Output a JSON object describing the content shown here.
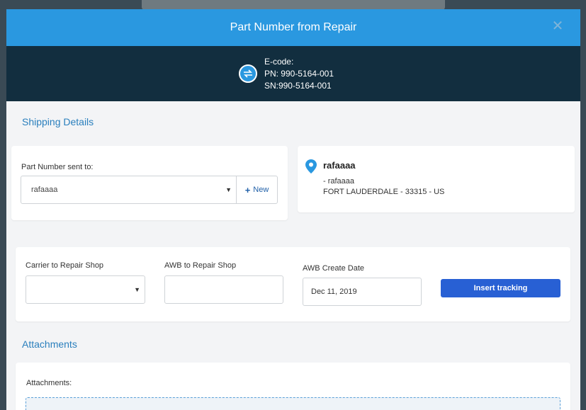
{
  "modal": {
    "title": "Part Number from Repair",
    "close_label": "✕"
  },
  "info": {
    "ecode": "E-code:",
    "pn": "PN: 990-5164-001",
    "sn": "SN:990-5164-001"
  },
  "shipping": {
    "section_title": "Shipping Details",
    "sent_to_label": "Part Number sent to:",
    "sent_to_value": "rafaaaa",
    "new_button": "New",
    "address": {
      "name": "rafaaaa",
      "line1": "- rafaaaa",
      "line2": "FORT LAUDERDALE - 33315 - US"
    }
  },
  "tracking": {
    "carrier_label": "Carrier to Repair Shop",
    "carrier_value": "",
    "awb_label": "AWB to Repair Shop",
    "awb_value": "",
    "date_label": "AWB Create Date",
    "date_value": "Dec 11, 2019",
    "insert_button": "Insert tracking"
  },
  "attachments": {
    "section_title": "Attachments",
    "label": "Attachments:"
  },
  "colors": {
    "header": "#2a98e0",
    "band": "#122e3f",
    "primary": "#2860d4",
    "accent_text": "#2a7fbd"
  }
}
